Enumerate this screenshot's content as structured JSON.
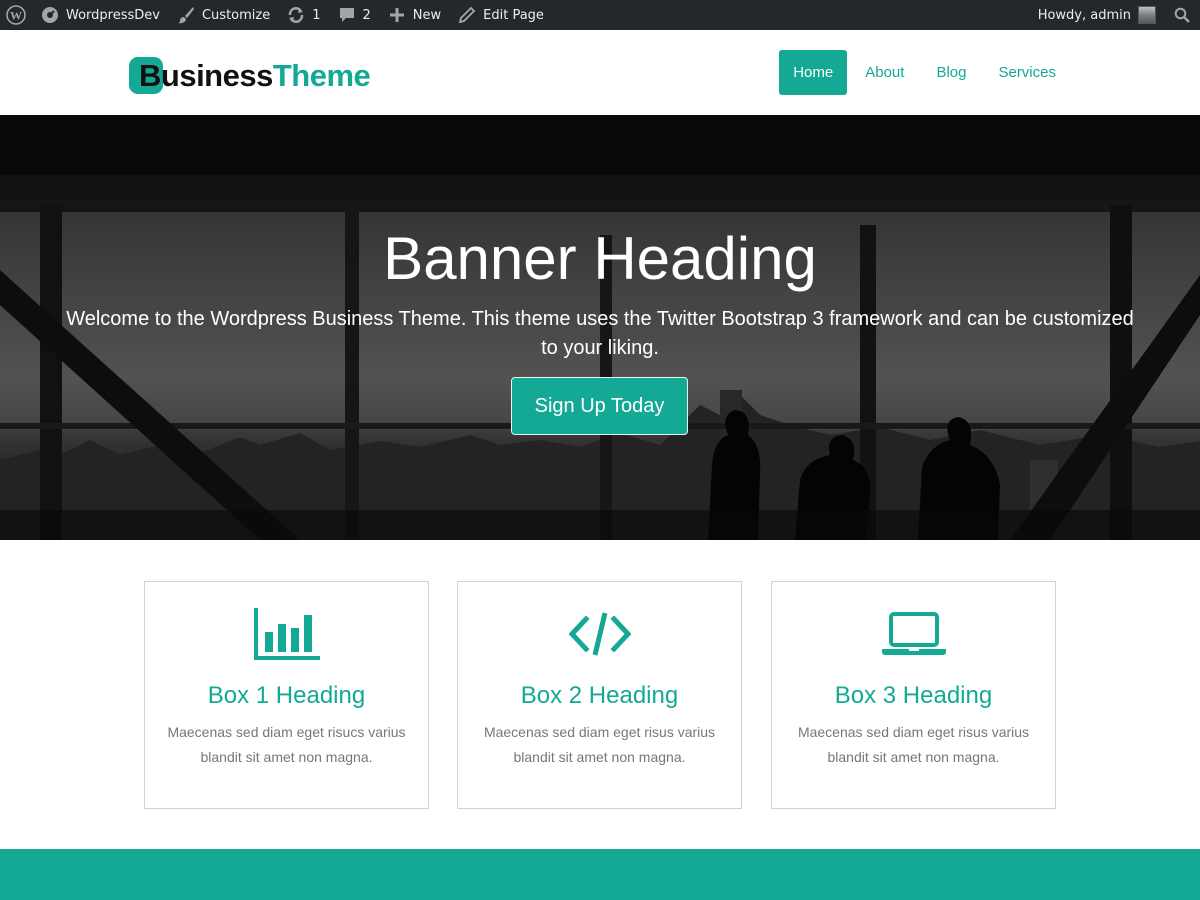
{
  "admin_bar": {
    "site_name": "WordpressDev",
    "customize": "Customize",
    "updates_count": "1",
    "comments_count": "2",
    "new_label": "New",
    "edit_page": "Edit Page",
    "greeting": "Howdy, admin"
  },
  "header": {
    "logo_business": "Business",
    "logo_theme": "Theme",
    "nav": [
      {
        "label": "Home",
        "active": true
      },
      {
        "label": "About"
      },
      {
        "label": "Blog"
      },
      {
        "label": "Services"
      }
    ]
  },
  "banner": {
    "heading": "Banner Heading",
    "text": "Welcome to the Wordpress Business Theme. This theme uses the Twitter Bootstrap 3 framework and can be customized to your liking.",
    "button": "Sign Up Today"
  },
  "boxes": [
    {
      "icon": "bar-chart-icon",
      "heading": "Box 1 Heading",
      "text": "Maecenas sed diam eget risucs varius blandit sit amet non magna."
    },
    {
      "icon": "code-icon",
      "heading": "Box 2 Heading",
      "text": "Maecenas sed diam eget risus varius blandit sit amet non magna."
    },
    {
      "icon": "laptop-icon",
      "heading": "Box 3 Heading",
      "text": "Maecenas sed diam eget risus varius blandit sit amet non magna."
    }
  ],
  "colors": {
    "accent": "#13a995",
    "admin_bar": "#23282d",
    "text_muted": "#777777"
  }
}
